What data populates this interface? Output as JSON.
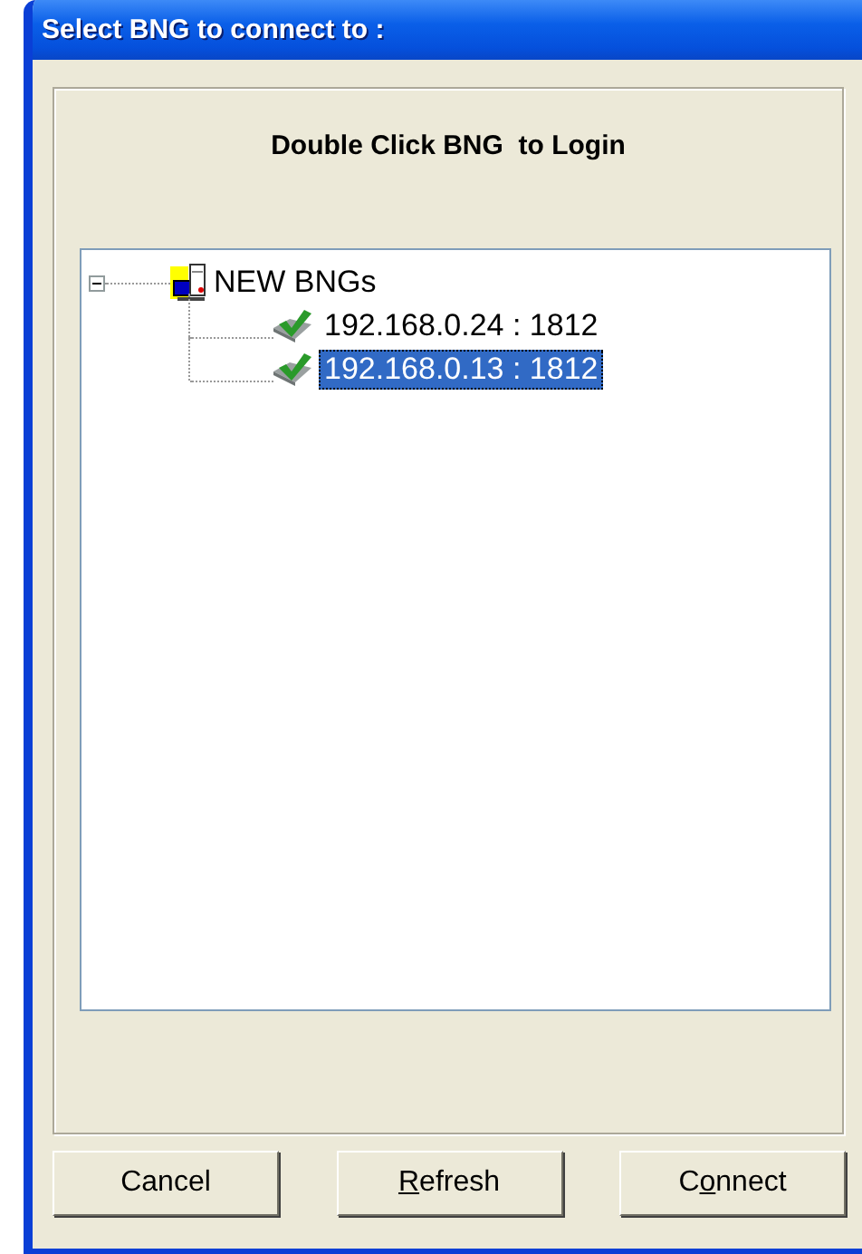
{
  "window": {
    "title": "Select BNG to connect to :"
  },
  "heading": "Double Click BNG  to Login",
  "tree": {
    "label": "NEW BNGs",
    "expanded": true,
    "children": [
      {
        "label": "192.168.0.24 : 1812",
        "selected": false
      },
      {
        "label": "192.168.0.13 : 1812",
        "selected": true
      }
    ]
  },
  "buttons": [
    {
      "label_start": "Cancel"
    },
    {
      "access_key": "R",
      "label_end": "efresh"
    },
    {
      "label_start": "C",
      "access_key": "o",
      "label_end": "nnect"
    }
  ]
}
